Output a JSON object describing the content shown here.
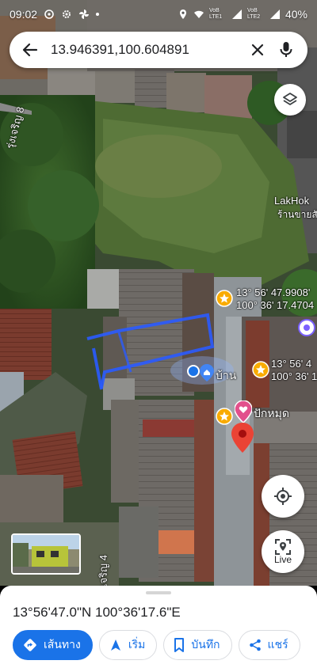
{
  "status_bar": {
    "time": "09:02",
    "battery": "40%",
    "signal1": "VoB LTE1",
    "signal2": "VoB LTE2"
  },
  "search": {
    "value": "13.946391,100.604891",
    "back_icon": "arrow-back-icon",
    "clear_icon": "close-icon",
    "mic_icon": "mic-icon"
  },
  "map": {
    "street_labels": [
      "รุ่งเจริญ 8",
      "เจริญ 4"
    ],
    "poi_top": "LakHok",
    "poi_top_sub": "ร้านขายสั",
    "pin1": {
      "lat": "13° 56' 47.9908'",
      "lng": "100° 36' 17.4704"
    },
    "pin2": {
      "lat": "13° 56' 4",
      "lng": "100° 36' 1"
    },
    "home_label": "บ้าน",
    "pakmud_label": "ปักหมุด",
    "live_label": "Live"
  },
  "sheet": {
    "coordinates": "13°56'47.0\"N 100°36'17.6\"E",
    "actions": [
      "เส้นทาง",
      "เริ่ม",
      "บันทึก",
      "แชร์"
    ]
  },
  "colors": {
    "accent": "#1a73e8",
    "pin_red": "#ea4335",
    "star_yellow": "#f9ab00",
    "polyline": "#2a5bff"
  }
}
